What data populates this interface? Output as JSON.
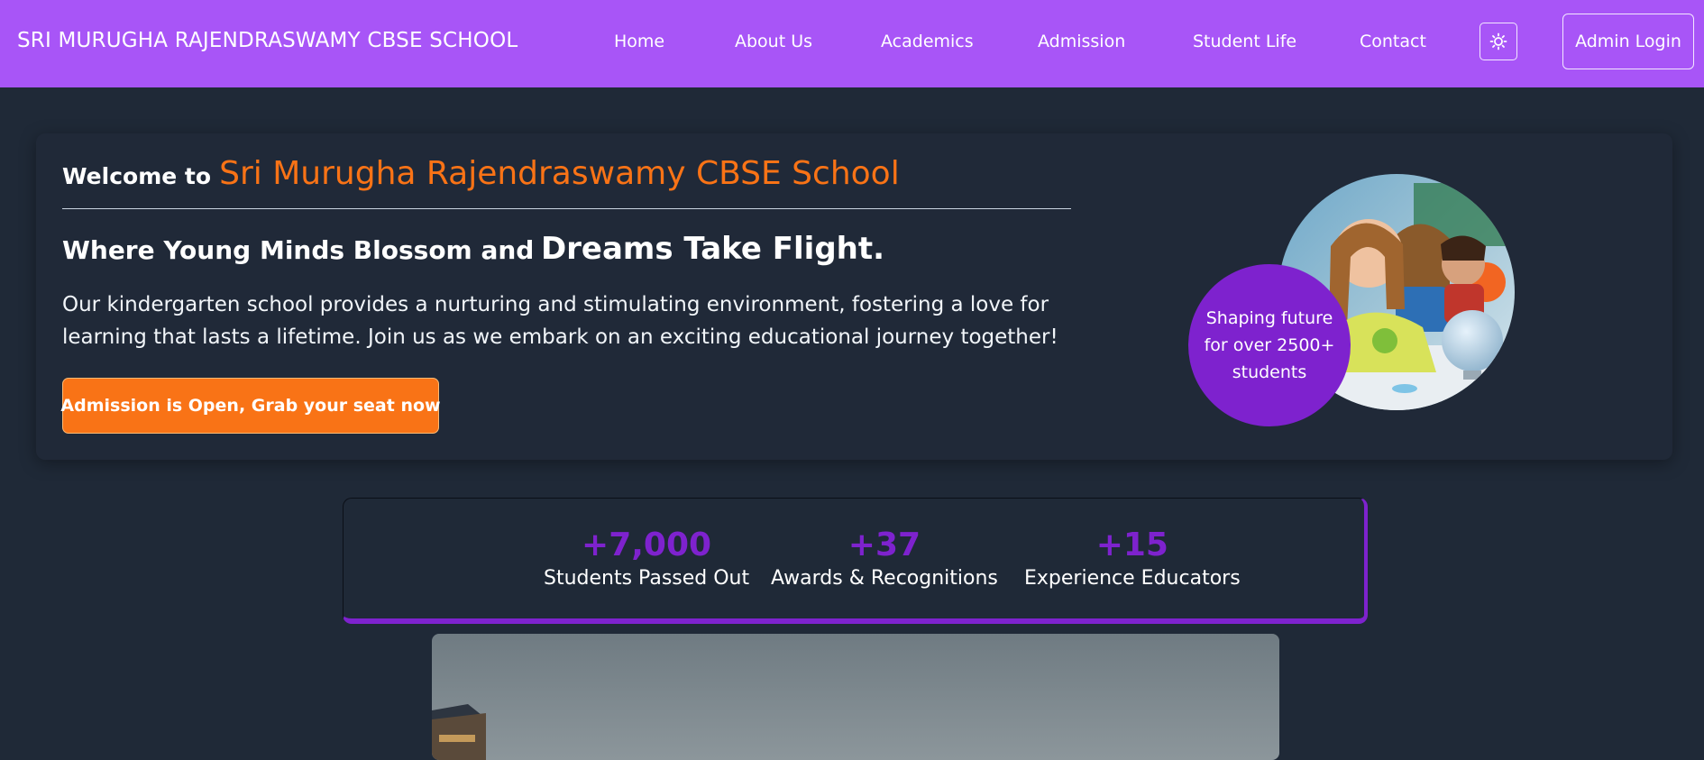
{
  "nav": {
    "brand": "SRI MURUGHA RAJENDRASWAMY CBSE SCHOOL",
    "links": [
      "Home",
      "About Us",
      "Academics",
      "Admission",
      "Student Life",
      "Contact"
    ],
    "theme_toggle_icon": "sun-icon",
    "admin_login": "Admin Login"
  },
  "hero": {
    "welcome_prefix": "Welcome to",
    "school_name": "Sri Murugha Rajendraswamy CBSE School",
    "tagline_start": "Where Young Minds Blossom and",
    "tagline_end": "Dreams Take Flight.",
    "description": "Our kindergarten school provides a nurturing and stimulating environment, fostering a love for learning that lasts a lifetime. Join us as we embark on an exciting educational journey together!",
    "cta": "Admission is Open, Grab your seat now",
    "badge": "Shaping future for over 2500+ students"
  },
  "stats": [
    {
      "value": "+7,000",
      "label": "Students Passed Out"
    },
    {
      "value": "+37",
      "label": "Awards & Recognitions"
    },
    {
      "value": "+15",
      "label": "Experience Educators"
    }
  ],
  "colors": {
    "nav_bg": "#a855f7",
    "page_bg": "#1f2937",
    "accent_orange": "#f97316",
    "accent_purple": "#7e22ce"
  }
}
